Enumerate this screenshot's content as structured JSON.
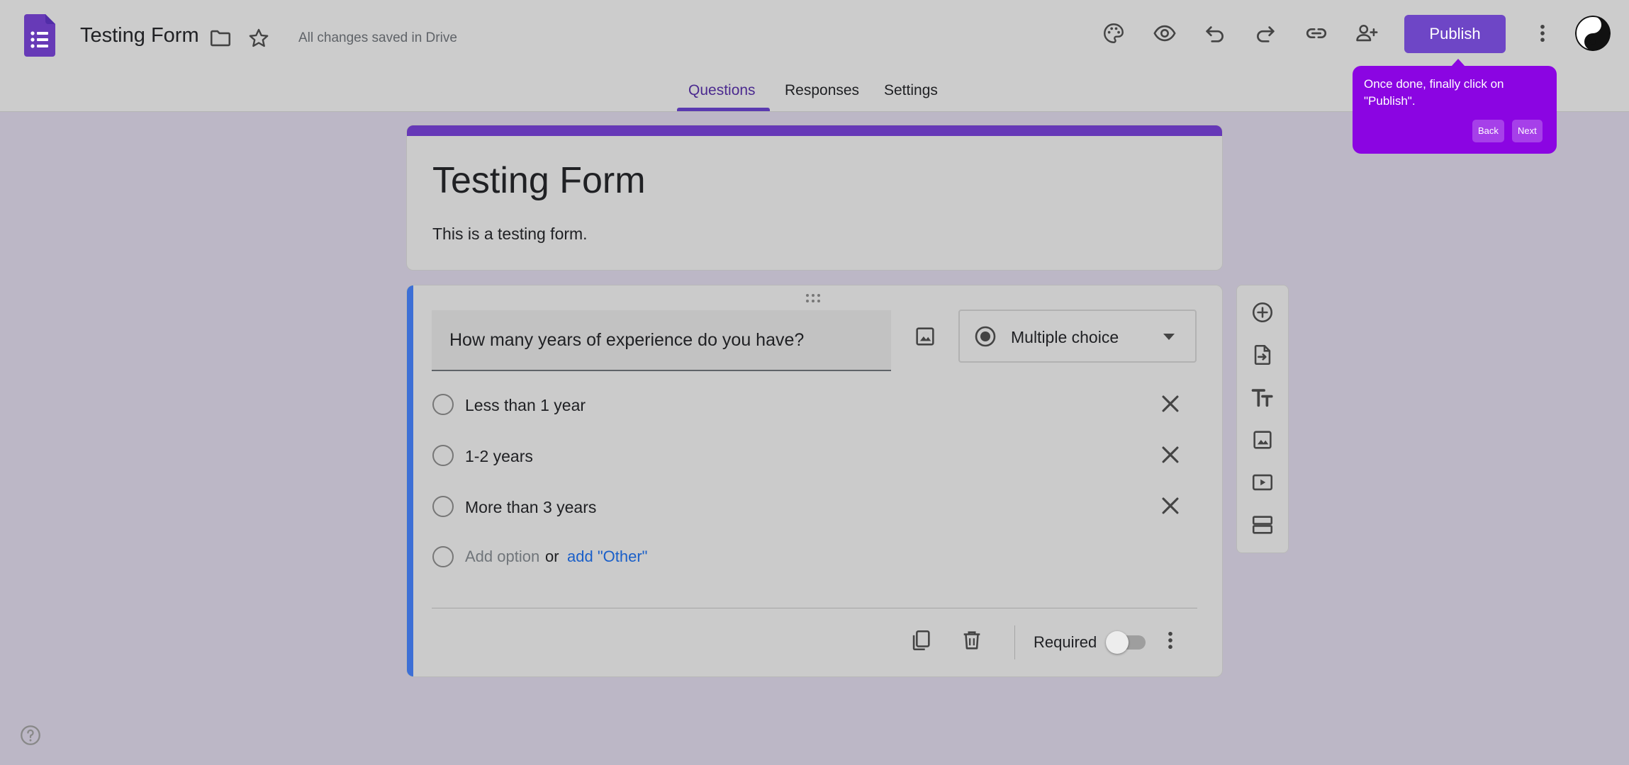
{
  "header": {
    "doc_title": "Testing Form",
    "saved_status": "All changes saved in Drive",
    "publish_label": "Publish",
    "icons": [
      "forms-logo-icon",
      "folder-icon",
      "star-icon",
      "palette-icon",
      "eye-icon",
      "undo-icon",
      "redo-icon",
      "link-icon",
      "add-person-icon",
      "more-vert-icon",
      "avatar"
    ]
  },
  "tabs": [
    {
      "label": "Questions",
      "active": true
    },
    {
      "label": "Responses",
      "active": false
    },
    {
      "label": "Settings",
      "active": false
    }
  ],
  "tooltip": {
    "text": "Once done, finally click on \"Publish\".",
    "back_label": "Back",
    "next_label": "Next"
  },
  "form": {
    "title": "Testing Form",
    "description": "This is a testing form."
  },
  "question": {
    "text": "How many years of experience do you have?",
    "type_label": "Multiple choice",
    "options": [
      "Less than 1 year",
      "1-2 years",
      "More than 3 years"
    ],
    "add_option": "Add option",
    "or_text": "or",
    "add_other": "add \"Other\"",
    "required_label": "Required",
    "required_on": false
  },
  "side_toolbar": [
    "add-question-icon",
    "import-questions-icon",
    "add-title-icon",
    "add-image-icon",
    "add-video-icon",
    "add-section-icon"
  ],
  "colors": {
    "accent": "#6e46c6",
    "tooltip": "#8b05e2",
    "question_bar": "#3d6fd6",
    "link": "#1a5fc9"
  }
}
